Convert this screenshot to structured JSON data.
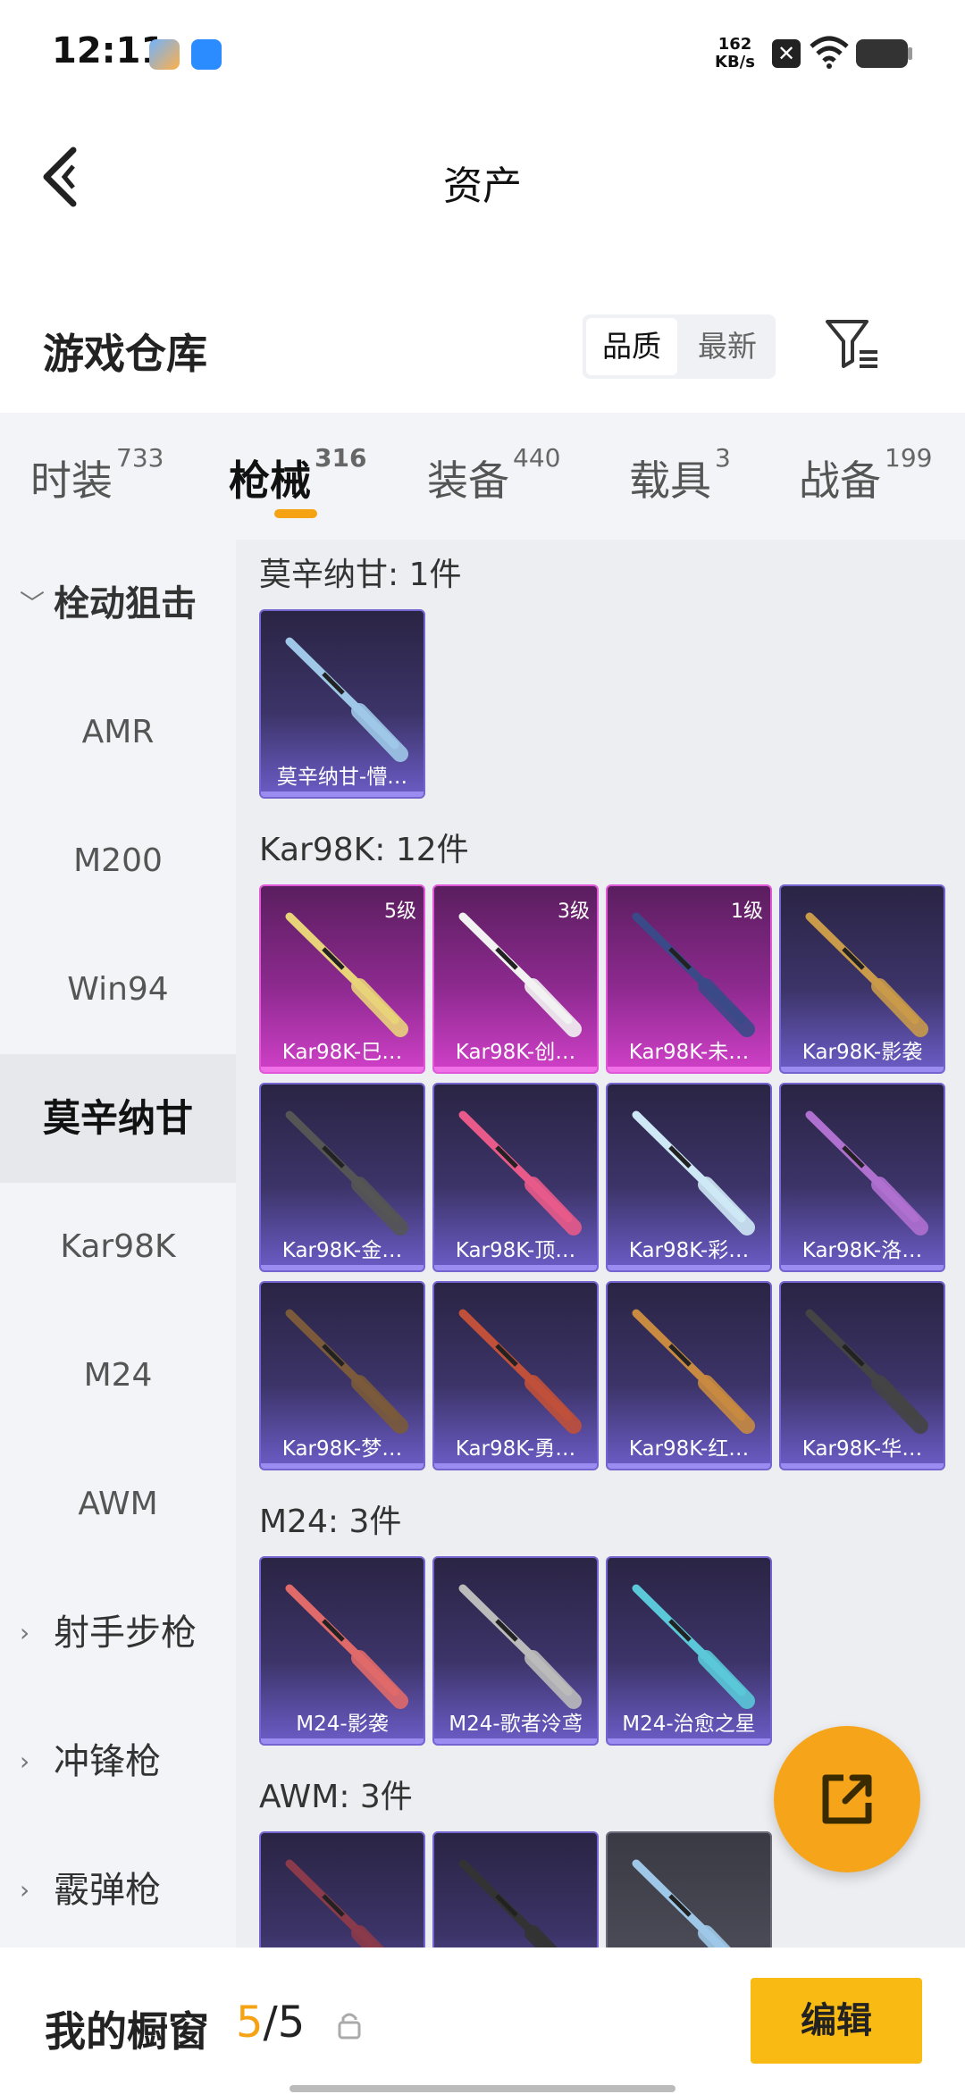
{
  "status_bar": {
    "time": "12:11",
    "net_speed": "162",
    "net_unit": "KB/s"
  },
  "header": {
    "title": "资产"
  },
  "warehouse": {
    "title": "游戏仓库",
    "sort_quality": "品质",
    "sort_newest": "最新"
  },
  "tabs": [
    {
      "label": "时装",
      "count": "733"
    },
    {
      "label": "枪械",
      "count": "316"
    },
    {
      "label": "装备",
      "count": "440"
    },
    {
      "label": "载具",
      "count": "3"
    },
    {
      "label": "战备",
      "count": "199"
    }
  ],
  "sidebar": {
    "category": "栓动狙击",
    "items": [
      "AMR",
      "M200",
      "Win94",
      "莫辛纳甘",
      "Kar98K",
      "M24",
      "AWM"
    ],
    "other_categories": [
      "射手步枪",
      "冲锋枪",
      "霰弹枪"
    ]
  },
  "sections": [
    {
      "title": "莫辛纳甘: 1件",
      "items": [
        {
          "label": "莫辛纳甘-懵…",
          "rarity": "purple"
        }
      ]
    },
    {
      "title": "Kar98K: 12件",
      "items": [
        {
          "label": "Kar98K-巳…",
          "rarity": "pink",
          "level": "5级"
        },
        {
          "label": "Kar98K-创…",
          "rarity": "pink",
          "level": "3级"
        },
        {
          "label": "Kar98K-未…",
          "rarity": "pink",
          "level": "1级"
        },
        {
          "label": "Kar98K-影袭",
          "rarity": "purple"
        },
        {
          "label": "Kar98K-金…",
          "rarity": "purple"
        },
        {
          "label": "Kar98K-顶…",
          "rarity": "purple"
        },
        {
          "label": "Kar98K-彩…",
          "rarity": "purple"
        },
        {
          "label": "Kar98K-洛…",
          "rarity": "purple"
        },
        {
          "label": "Kar98K-梦…",
          "rarity": "purple"
        },
        {
          "label": "Kar98K-勇…",
          "rarity": "purple"
        },
        {
          "label": "Kar98K-红…",
          "rarity": "purple"
        },
        {
          "label": "Kar98K-华…",
          "rarity": "purple"
        }
      ]
    },
    {
      "title": "M24: 3件",
      "items": [
        {
          "label": "M24-影袭",
          "rarity": "purple"
        },
        {
          "label": "M24-歌者泠鸢",
          "rarity": "purple"
        },
        {
          "label": "M24-治愈之星",
          "rarity": "purple"
        }
      ]
    },
    {
      "title": "AWM: 3件",
      "items": [
        {
          "label": "",
          "rarity": "purple"
        },
        {
          "label": "",
          "rarity": "purple"
        },
        {
          "label": "",
          "rarity": "gray"
        }
      ]
    }
  ],
  "showcase": {
    "title": "我的橱窗",
    "current": "5",
    "separator": "/",
    "total": "5",
    "edit_label": "编辑"
  },
  "colors": {
    "accent": "#f5a313",
    "button": "#f8ba13",
    "purple_card": "#6c5cc8",
    "pink_card": "#d040c8"
  }
}
